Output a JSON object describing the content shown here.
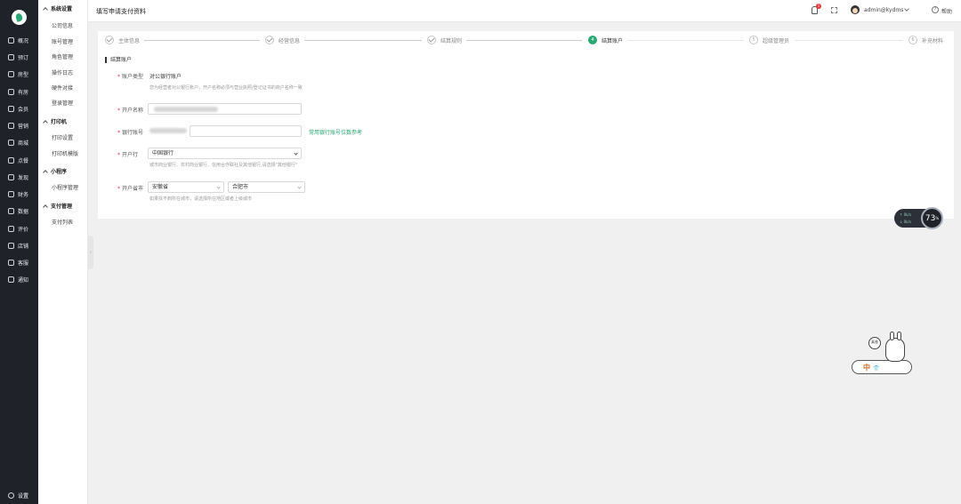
{
  "nav": {
    "items": [
      {
        "label": "概况",
        "icon": "dashboard-icon"
      },
      {
        "label": "预订",
        "icon": "calendar-icon"
      },
      {
        "label": "房型",
        "icon": "house-icon"
      },
      {
        "label": "有房",
        "icon": "bell-icon"
      },
      {
        "label": "会员",
        "icon": "user-icon"
      },
      {
        "label": "营销",
        "icon": "megaphone-icon"
      },
      {
        "label": "商城",
        "icon": "store-icon"
      },
      {
        "label": "点餐",
        "icon": "dish-icon"
      },
      {
        "label": "发现",
        "icon": "compass-icon"
      },
      {
        "label": "财务",
        "icon": "finance-icon"
      },
      {
        "label": "数据",
        "icon": "chart-icon"
      },
      {
        "label": "评价",
        "icon": "star-icon"
      },
      {
        "label": "店铺",
        "icon": "shop-icon"
      },
      {
        "label": "客服",
        "icon": "headset-icon"
      },
      {
        "label": "通知",
        "icon": "mail-icon"
      }
    ],
    "settings": "设置"
  },
  "submenu": {
    "groups": [
      {
        "title": "系统设置",
        "items": [
          "公司信息",
          "账号管理",
          "角色管理",
          "操作日志",
          "硬件对接",
          "登录管理"
        ]
      },
      {
        "title": "打印机",
        "items": [
          "打印设置",
          "打印机模版"
        ]
      },
      {
        "title": "小程序",
        "items": [
          "小程序管理"
        ]
      },
      {
        "title": "支付管理",
        "items": [
          "支付列表"
        ]
      }
    ]
  },
  "topbar": {
    "title": "填写申请支付资料",
    "notification_count": "1",
    "username": "admin@kydms",
    "help": "帮助"
  },
  "steps": [
    {
      "num": "1",
      "label": "主体信息",
      "status": "done"
    },
    {
      "num": "2",
      "label": "经营信息",
      "status": "done"
    },
    {
      "num": "3",
      "label": "结算规则",
      "status": "done"
    },
    {
      "num": "4",
      "label": "结算账户",
      "status": "current"
    },
    {
      "num": "5",
      "label": "超级管理员",
      "status": "pending"
    },
    {
      "num": "6",
      "label": "补充材料",
      "status": "pending"
    }
  ],
  "section": {
    "title": "结算账户"
  },
  "form": {
    "account_type": {
      "label": "账户类型",
      "value": "对公银行账户",
      "hint": "您为经营者对公银行账户，开户名称必须与营业执照/登记证书的商户名称一致"
    },
    "account_name": {
      "label": "开户名称"
    },
    "bank_account": {
      "label": "银行账号",
      "link": "常用银行账号位数参考"
    },
    "bank": {
      "label": "开户行",
      "value": "中国银行",
      "hint": "城市商业银行、农村商业银行、信用合作联社及其他银行,请选择\"其他银行\""
    },
    "city": {
      "label": "开户省市",
      "province": "安徽省",
      "city": "合肥市",
      "hint": "如果找不到所在城市，请选择所在地区或者上级城市"
    }
  },
  "speed_widget": {
    "up": "0k/s",
    "down": "0k/s",
    "percent": "73",
    "unit": "%"
  },
  "ime": {
    "text": "中",
    "bubble": "真香"
  }
}
